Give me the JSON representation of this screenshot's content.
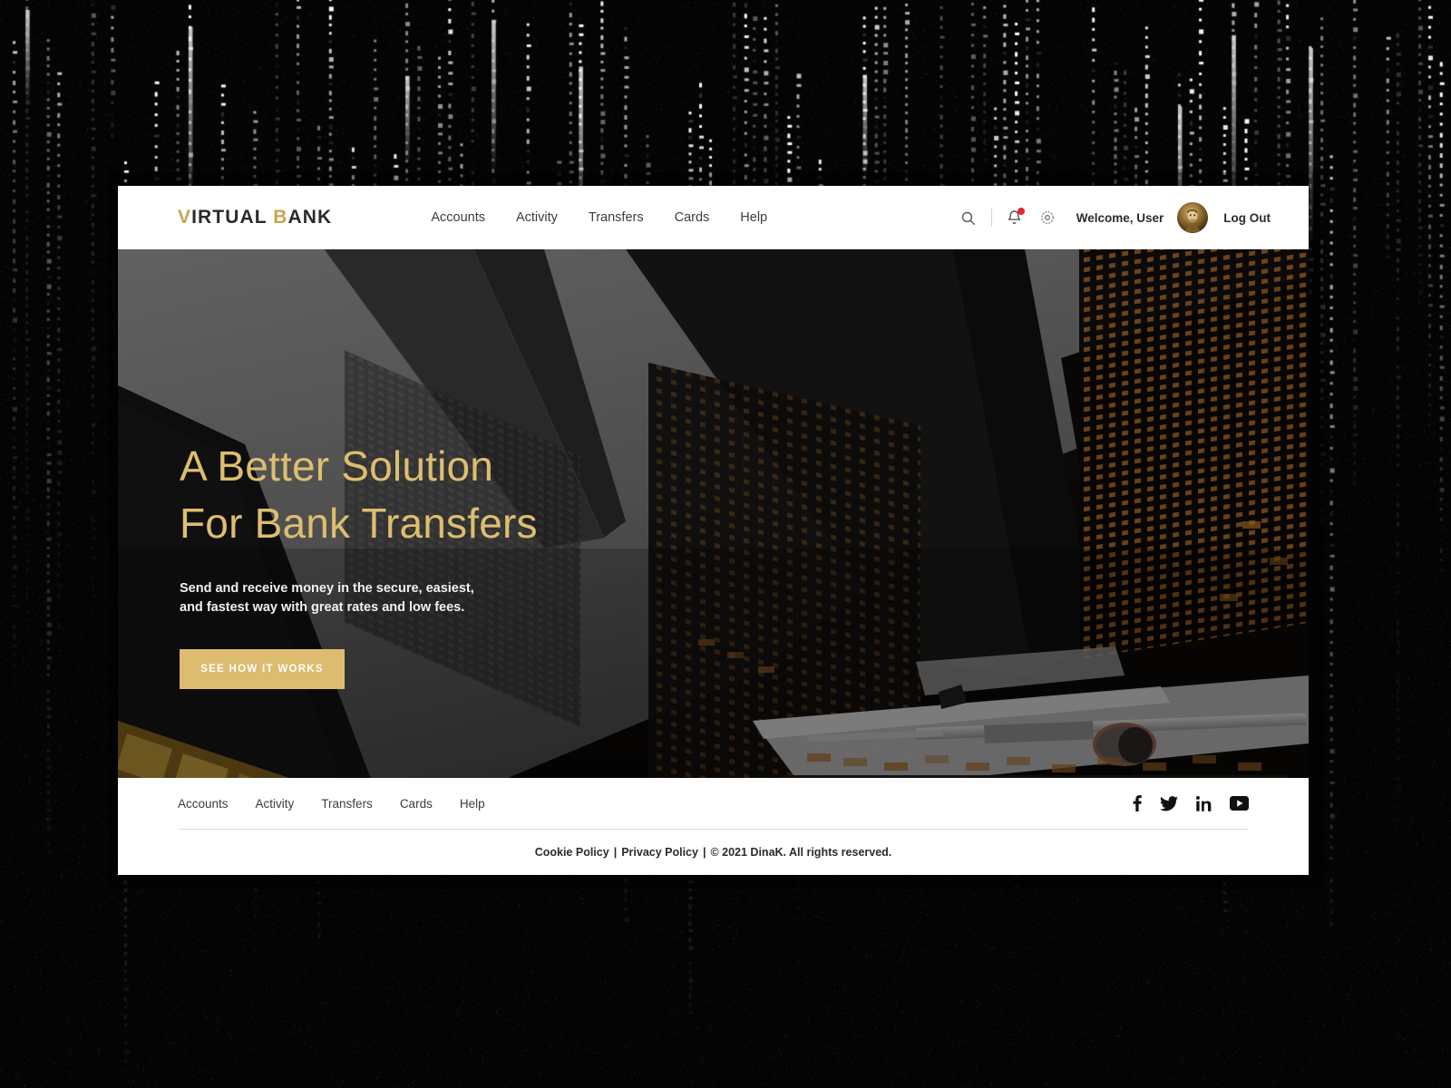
{
  "brand": {
    "logo_first_letter": "V",
    "logo_rest": "IRTUAL ",
    "logo_b": "B",
    "logo_tail": "ANK",
    "gold": "#dcbc6e",
    "accent_red": "#e7262a"
  },
  "header": {
    "nav": [
      {
        "label": "Accounts"
      },
      {
        "label": "Activity"
      },
      {
        "label": "Transfers"
      },
      {
        "label": "Cards"
      },
      {
        "label": "Help"
      }
    ],
    "search_icon": "search-icon",
    "notification_icon": "bell-icon",
    "settings_icon": "gear-icon",
    "welcome": "Welcome, User",
    "logout": "Log Out",
    "avatar_alt": "user-avatar"
  },
  "hero": {
    "title_line1": "A Better Solution",
    "title_line2": "For Bank Transfers",
    "subtitle_line1": "Send and receive money in the secure, easiest, and",
    "subtitle_line2": "fastest way with great rates and low fees.",
    "cta_label": "SEE HOW IT WORKS"
  },
  "footer": {
    "nav": [
      {
        "label": "Accounts"
      },
      {
        "label": "Activity"
      },
      {
        "label": "Transfers"
      },
      {
        "label": "Cards"
      },
      {
        "label": "Help"
      }
    ],
    "social": [
      {
        "name": "facebook-icon",
        "label": "f"
      },
      {
        "name": "twitter-icon",
        "label": "Twitter"
      },
      {
        "name": "linkedin-icon",
        "label": "in"
      },
      {
        "name": "youtube-icon",
        "label": "YouTube"
      }
    ],
    "cookie_policy": "Cookie Policy",
    "sep1": "|",
    "privacy_policy": "Privacy Policy",
    "sep2": "|",
    "copyright": "© 2021 DinaK. All rights reserved."
  }
}
